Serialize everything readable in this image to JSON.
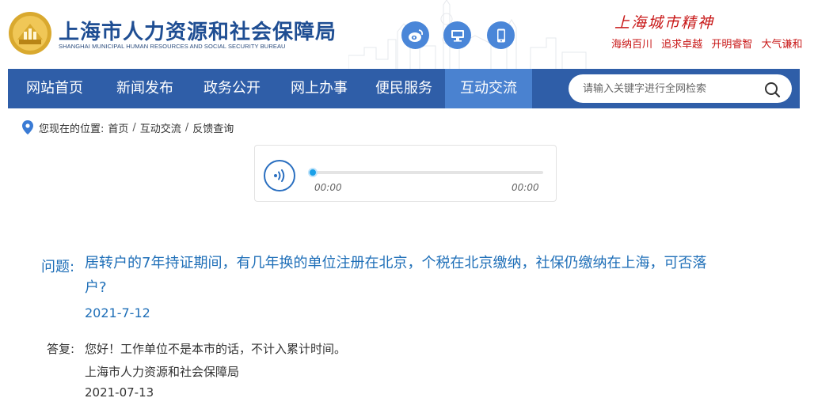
{
  "header": {
    "site_title": "上海市人力资源和社会保障局",
    "site_subtitle": "SHANGHAI MUNICIPAL HUMAN RESOURCES AND SOCIAL SECURITY BUREAU",
    "logo_icon": "bureau-emblem-icon",
    "social_icons": [
      "weibo-icon",
      "desktop-icon",
      "mobile-icon"
    ],
    "spirit_title": "上海城市精神",
    "spirit_items": [
      "海纳百川",
      "追求卓越",
      "开明睿智",
      "大气谦和"
    ]
  },
  "nav": {
    "items": [
      {
        "label": "网站首页"
      },
      {
        "label": "新闻发布"
      },
      {
        "label": "政务公开"
      },
      {
        "label": "网上办事"
      },
      {
        "label": "便民服务"
      },
      {
        "label": "互动交流"
      }
    ],
    "active_index": 5,
    "search_placeholder": "请输入关键字进行全网检索"
  },
  "breadcrumb": {
    "prefix": "您现在的位置:",
    "items": [
      "首页",
      "互动交流",
      "反馈查询"
    ]
  },
  "player": {
    "current_time": "00:00",
    "duration": "00:00",
    "progress": 0
  },
  "question": {
    "label": "问题:",
    "text": "居转户的7年持证期间，有几年换的单位注册在北京，个税在北京缴纳，社保仍缴纳在上海，可否落户?",
    "date": "2021-7-12"
  },
  "answer": {
    "label": "答复:",
    "text": "您好！工作单位不是本市的话，不计入累计时间。",
    "org": "上海市人力资源和社会保障局",
    "date": "2021-07-13"
  },
  "colors": {
    "nav_bg": "#2f5ea8",
    "nav_active": "#4a82d0",
    "title_blue": "#1f4e93",
    "question_blue": "#1f6fb8",
    "spirit_red": "#c81717",
    "player_knob": "#1aa0e8"
  }
}
